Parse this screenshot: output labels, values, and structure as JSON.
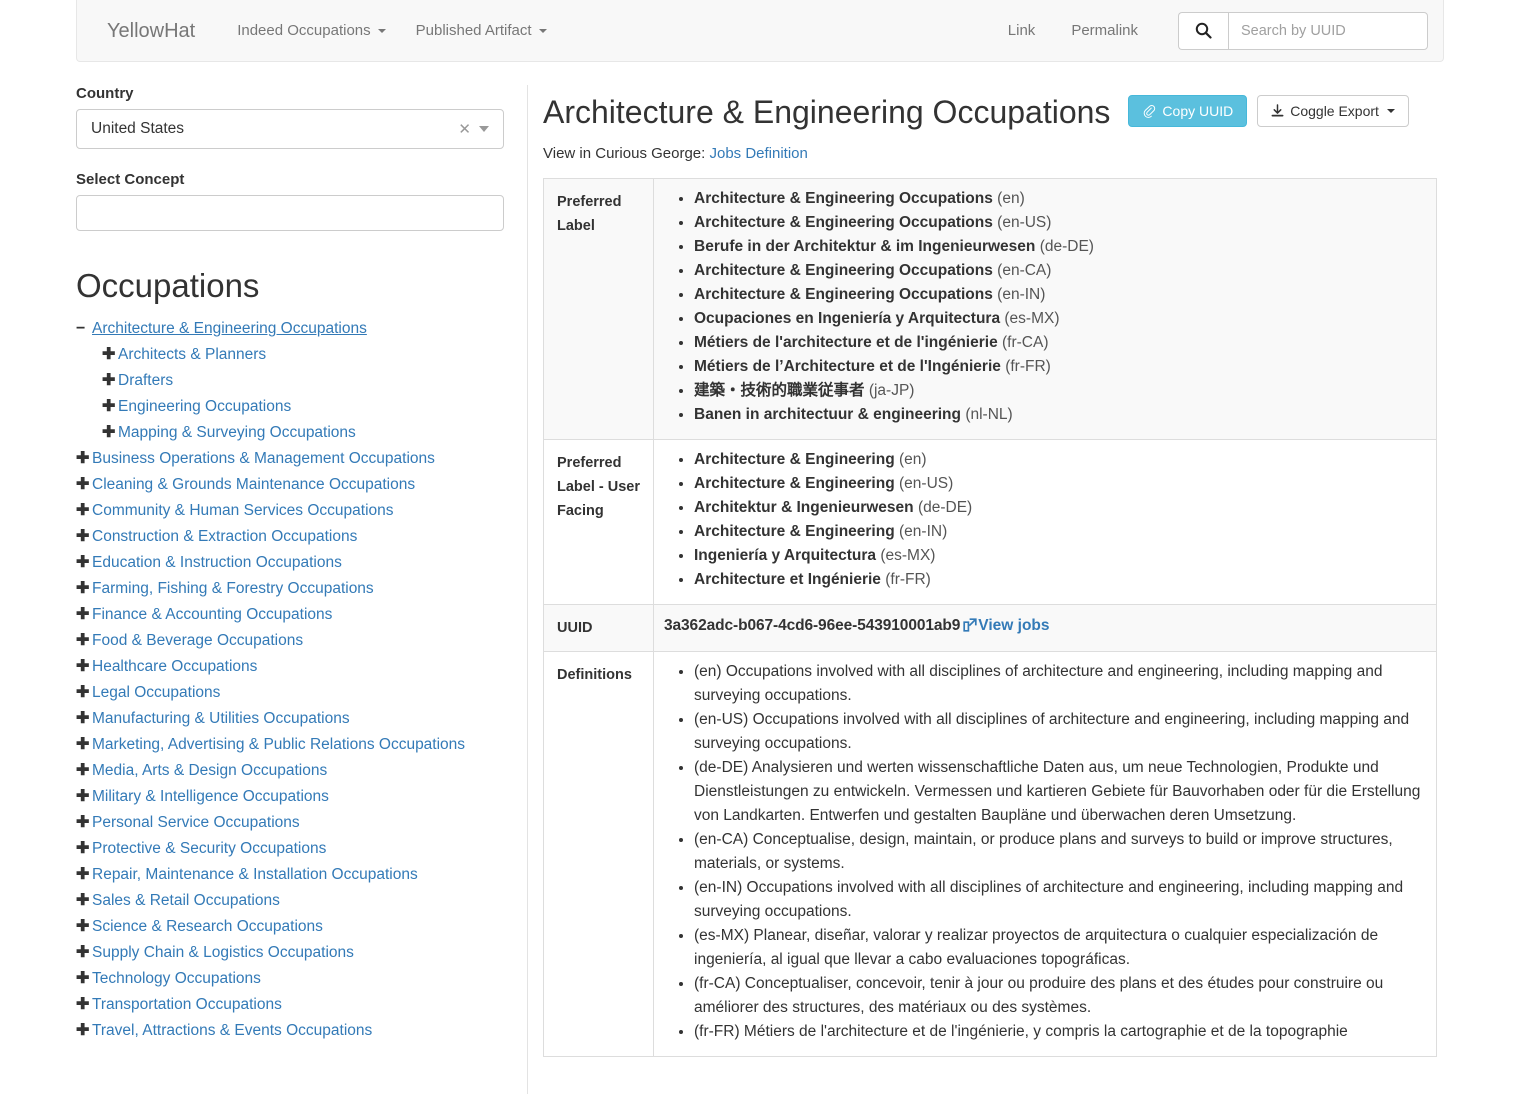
{
  "navbar": {
    "brand": "YellowHat",
    "menus": [
      {
        "label": "Indeed Occupations"
      },
      {
        "label": "Published Artifact"
      }
    ],
    "links": [
      {
        "label": "Link"
      },
      {
        "label": "Permalink"
      }
    ],
    "search": {
      "placeholder": "Search by UUID",
      "value": "",
      "icon": "search-icon"
    }
  },
  "sidebar": {
    "country_label": "Country",
    "country_value": "United States",
    "concept_label": "Select Concept",
    "concept_value": "",
    "concept_placeholder": "",
    "occupations_title": "Occupations",
    "tree": [
      {
        "label": "Architecture & Engineering Occupations",
        "toggle": "−",
        "active": true,
        "children": [
          {
            "label": "Architects & Planners",
            "toggle": "✚"
          },
          {
            "label": "Drafters",
            "toggle": "✚"
          },
          {
            "label": "Engineering Occupations",
            "toggle": "✚"
          },
          {
            "label": "Mapping & Surveying Occupations",
            "toggle": "✚"
          }
        ]
      },
      {
        "label": "Business Operations & Management Occupations",
        "toggle": "✚"
      },
      {
        "label": "Cleaning & Grounds Maintenance Occupations",
        "toggle": "✚"
      },
      {
        "label": "Community & Human Services Occupations",
        "toggle": "✚"
      },
      {
        "label": "Construction & Extraction Occupations",
        "toggle": "✚"
      },
      {
        "label": "Education & Instruction Occupations",
        "toggle": "✚"
      },
      {
        "label": "Farming, Fishing & Forestry Occupations",
        "toggle": "✚"
      },
      {
        "label": "Finance & Accounting Occupations",
        "toggle": "✚"
      },
      {
        "label": "Food & Beverage Occupations",
        "toggle": "✚"
      },
      {
        "label": "Healthcare Occupations",
        "toggle": "✚"
      },
      {
        "label": "Legal Occupations",
        "toggle": "✚"
      },
      {
        "label": "Manufacturing & Utilities Occupations",
        "toggle": "✚"
      },
      {
        "label": "Marketing, Advertising & Public Relations Occupations",
        "toggle": "✚"
      },
      {
        "label": "Media, Arts & Design Occupations",
        "toggle": "✚"
      },
      {
        "label": "Military & Intelligence Occupations",
        "toggle": "✚"
      },
      {
        "label": "Personal Service Occupations",
        "toggle": "✚"
      },
      {
        "label": "Protective & Security Occupations",
        "toggle": "✚"
      },
      {
        "label": "Repair, Maintenance & Installation Occupations",
        "toggle": "✚"
      },
      {
        "label": "Sales & Retail Occupations",
        "toggle": "✚"
      },
      {
        "label": "Science & Research Occupations",
        "toggle": "✚"
      },
      {
        "label": "Supply Chain & Logistics Occupations",
        "toggle": "✚"
      },
      {
        "label": "Technology Occupations",
        "toggle": "✚"
      },
      {
        "label": "Transportation Occupations",
        "toggle": "✚"
      },
      {
        "label": "Travel, Attractions & Events Occupations",
        "toggle": "✚"
      }
    ]
  },
  "main": {
    "title": "Architecture & Engineering Occupations",
    "copy_uuid_label": "Copy UUID",
    "export_label": "Coggle Export",
    "subline_prefix": "View in Curious George:",
    "subline_link": "Jobs Definition",
    "rows": {
      "preferred_label_header": "Preferred Label",
      "preferred_label": [
        {
          "text": "Architecture & Engineering Occupations",
          "lang": "(en)"
        },
        {
          "text": "Architecture & Engineering Occupations",
          "lang": "(en-US)"
        },
        {
          "text": "Berufe in der Architektur & im Ingenieurwesen",
          "lang": "(de-DE)"
        },
        {
          "text": "Architecture & Engineering Occupations",
          "lang": "(en-CA)"
        },
        {
          "text": "Architecture & Engineering Occupations",
          "lang": "(en-IN)"
        },
        {
          "text": "Ocupaciones en Ingeniería y Arquitectura",
          "lang": "(es-MX)"
        },
        {
          "text": "Métiers de l'architecture et de l'ingénierie",
          "lang": "(fr-CA)"
        },
        {
          "text": "Métiers de l’Architecture et de l'Ingénierie",
          "lang": "(fr-FR)"
        },
        {
          "text": "建築・技術的職業従事者",
          "lang": "(ja-JP)"
        },
        {
          "text": "Banen in architectuur & engineering",
          "lang": "(nl-NL)"
        }
      ],
      "user_facing_header": "Preferred Label - User Facing",
      "user_facing": [
        {
          "text": "Architecture & Engineering",
          "lang": "(en)"
        },
        {
          "text": "Architecture & Engineering",
          "lang": "(en-US)"
        },
        {
          "text": "Architektur & Ingenieurwesen",
          "lang": "(de-DE)"
        },
        {
          "text": "Architecture & Engineering",
          "lang": "(en-IN)"
        },
        {
          "text": "Ingeniería y Arquitectura",
          "lang": "(es-MX)"
        },
        {
          "text": "Architecture et Ingénierie",
          "lang": "(fr-FR)"
        }
      ],
      "uuid_header": "UUID",
      "uuid_value": "3a362adc-b067-4cd6-96ee-543910001ab9",
      "view_jobs_label": "View jobs",
      "definitions_header": "Definitions",
      "definitions": [
        "(en) Occupations involved with all disciplines of architecture and engineering, including mapping and surveying occupations.",
        "(en-US) Occupations involved with all disciplines of architecture and engineering, including mapping and surveying occupations.",
        "(de-DE) Analysieren und werten wissenschaftliche Daten aus, um neue Technologien, Produkte und Dienstleistungen zu entwickeln. Vermessen und kartieren Gebiete für Bauvorhaben oder für die Erstellung von Landkarten. Entwerfen und gestalten Baupläne und überwachen deren Umsetzung.",
        "(en-CA) Conceptualise, design, maintain, or produce plans and surveys to build or improve structures, materials, or systems.",
        "(en-IN) Occupations involved with all disciplines of architecture and engineering, including mapping and surveying occupations.",
        "(es-MX) Planear, diseñar, valorar y realizar proyectos de arquitectura o cualquier especialización de ingeniería, al igual que llevar a cabo evaluaciones topográficas.",
        "(fr-CA) Conceptualiser, concevoir, tenir à jour ou produire des plans et des études pour construire ou améliorer des structures, des matériaux ou des systèmes.",
        "(fr-FR) Métiers de l'architecture et de l'ingénierie, y compris la cartographie et de la topographie"
      ]
    }
  },
  "colors": {
    "link": "#337ab7",
    "info_button": "#5bc0de",
    "navbar_bg": "#f8f8f8",
    "stripe": "#f9f9f9"
  }
}
